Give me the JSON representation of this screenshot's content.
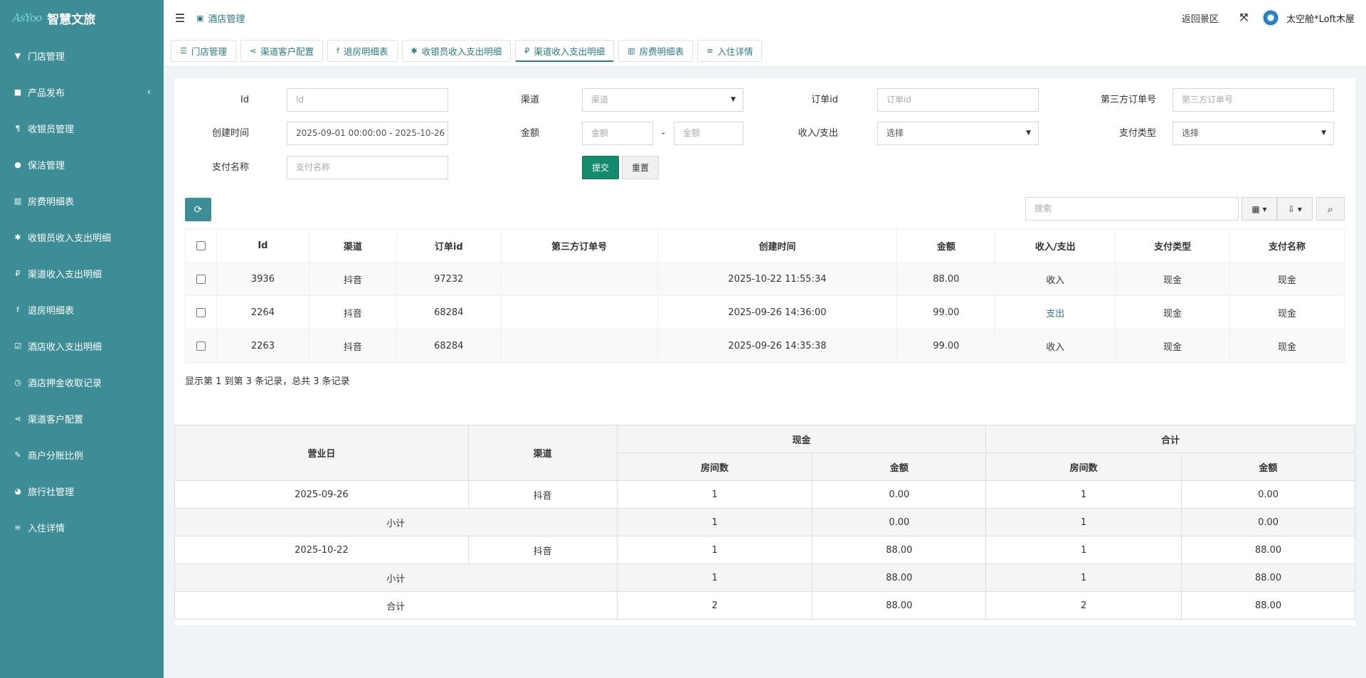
{
  "app": {
    "logo_mark": "AsYoo",
    "title": "智慧文旅"
  },
  "sidebar": {
    "items": [
      {
        "label": "门店管理",
        "icon": "filter-icon",
        "glyph": "▼"
      },
      {
        "label": "产品发布",
        "icon": "product-icon",
        "glyph": "■",
        "expand": "‹"
      },
      {
        "label": "收银员管理",
        "icon": "paragraph-icon",
        "glyph": "¶"
      },
      {
        "label": "保洁管理",
        "icon": "user-icon",
        "glyph": "●"
      },
      {
        "label": "房费明细表",
        "icon": "bar-chart-icon",
        "glyph": "▥"
      },
      {
        "label": "收银员收入支出明细",
        "icon": "asterisk-icon",
        "glyph": "✱"
      },
      {
        "label": "渠道收入支出明细",
        "icon": "ruble-icon",
        "glyph": "₽"
      },
      {
        "label": "退房明细表",
        "icon": "facebook-icon",
        "glyph": "f"
      },
      {
        "label": "酒店收入支出明细",
        "icon": "check-square-icon",
        "glyph": "☑"
      },
      {
        "label": "酒店押金收取记录",
        "icon": "clock-icon",
        "glyph": "◷"
      },
      {
        "label": "渠道客户配置",
        "icon": "share-icon",
        "glyph": "⋖"
      },
      {
        "label": "商户分账比例",
        "icon": "gavel-icon",
        "glyph": "✎"
      },
      {
        "label": "旅行社管理",
        "icon": "globe-icon",
        "glyph": "◕"
      },
      {
        "label": "入住详情",
        "icon": "html5-icon",
        "glyph": "≡"
      }
    ]
  },
  "header": {
    "menu_glyph": "☰",
    "title": "酒店管理",
    "title_glyph": "▣",
    "back_label": "返回景区",
    "fullscreen_glyph": "⤧",
    "user_name": "太空舱*Loft木屋"
  },
  "tabs": [
    {
      "label": "门店管理",
      "glyph": "☰"
    },
    {
      "label": "渠道客户配置",
      "glyph": "⋖"
    },
    {
      "label": "退房明细表",
      "glyph": "f"
    },
    {
      "label": "收银员收入支出明细",
      "glyph": "✱"
    },
    {
      "label": "渠道收入支出明细",
      "glyph": "₽",
      "active": true
    },
    {
      "label": "房费明细表",
      "glyph": "▥"
    },
    {
      "label": "入住详情",
      "glyph": "≡"
    }
  ],
  "form": {
    "id_label": "Id",
    "id_placeholder": "Id",
    "channel_label": "渠道",
    "channel_placeholder": "渠道",
    "order_label": "订单id",
    "order_placeholder": "订单id",
    "third_label": "第三方订单号",
    "third_placeholder": "第三方订单号",
    "created_label": "创建时间",
    "created_value": "2025-09-01 00:00:00 - 2025-10-26",
    "amount_label": "金额",
    "amount_min_placeholder": "金额",
    "amount_sep": "-",
    "amount_max_placeholder": "金额",
    "inout_label": "收入/支出",
    "inout_value": "选择",
    "paytype_label": "支付类型",
    "paytype_value": "选择",
    "payname_label": "支付名称",
    "payname_placeholder": "支付名称",
    "submit": "提交",
    "reset": "重置",
    "caret": "▼"
  },
  "toolbar": {
    "refresh_glyph": "⟳",
    "search_placeholder": "搜索",
    "columns_glyph": "▦ ▾",
    "export_glyph": "⇩ ▾",
    "search_glyph": "⌕"
  },
  "table": {
    "headers": [
      "Id",
      "渠道",
      "订单id",
      "第三方订单号",
      "创建时间",
      "金额",
      "收入/支出",
      "支付类型",
      "支付名称"
    ],
    "rows": [
      {
        "id": "3936",
        "channel": "抖音",
        "order": "97232",
        "third": "",
        "created": "2025-10-22 11:55:34",
        "amount": "88.00",
        "inout": "收入",
        "paytype": "现金",
        "payname": "现金"
      },
      {
        "id": "2264",
        "channel": "抖音",
        "order": "68284",
        "third": "",
        "created": "2025-09-26 14:36:00",
        "amount": "99.00",
        "inout": "支出",
        "paytype": "现金",
        "payname": "现金"
      },
      {
        "id": "2263",
        "channel": "抖音",
        "order": "68284",
        "third": "",
        "created": "2025-09-26 14:35:38",
        "amount": "99.00",
        "inout": "收入",
        "paytype": "现金",
        "payname": "现金"
      }
    ],
    "pager": "显示第 1 到第 3 条记录，总共 3 条记录"
  },
  "summary": {
    "h_day": "营业日",
    "h_channel": "渠道",
    "h_cash": "现金",
    "h_total": "合计",
    "h_rooms": "房间数",
    "h_amount": "金额",
    "rows": [
      {
        "day": "2025-09-26",
        "channel": "抖音",
        "cash_rooms": "1",
        "cash_amount": "0.00",
        "total_rooms": "1",
        "total_amount": "0.00"
      },
      {
        "subtotal": "小计",
        "cash_rooms": "1",
        "cash_amount": "0.00",
        "total_rooms": "1",
        "total_amount": "0.00"
      },
      {
        "day": "2025-10-22",
        "channel": "抖音",
        "cash_rooms": "1",
        "cash_amount": "88.00",
        "total_rooms": "1",
        "total_amount": "88.00"
      },
      {
        "subtotal": "小计",
        "cash_rooms": "1",
        "cash_amount": "88.00",
        "total_rooms": "1",
        "total_amount": "88.00"
      },
      {
        "grand": "合计",
        "cash_rooms": "2",
        "cash_amount": "88.00",
        "total_rooms": "2",
        "total_amount": "88.00"
      }
    ]
  }
}
